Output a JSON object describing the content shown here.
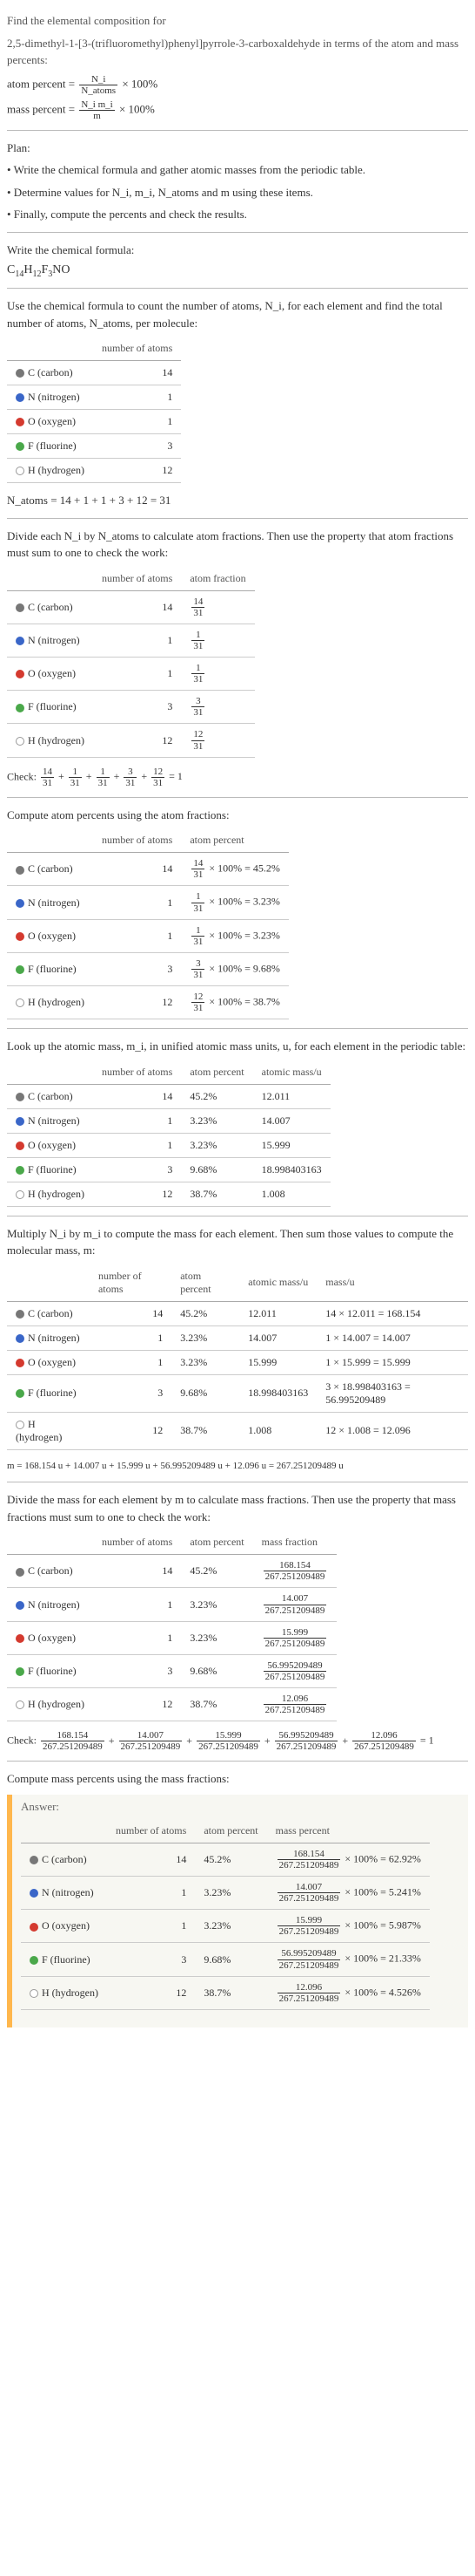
{
  "intro": {
    "line1": "Find the elemental composition for",
    "line2": "2,5-dimethyl-1-[3-(trifluoromethyl)phenyl]pyrrole-3-carboxaldehyde in terms of the atom and mass percents:"
  },
  "defs": {
    "atom_percent_prefix": "atom percent = ",
    "atom_percent_frac_num": "N_i",
    "atom_percent_frac_den": "N_atoms",
    "atom_percent_suffix": " × 100%",
    "mass_percent_prefix": "mass percent = ",
    "mass_percent_frac_num": "N_i m_i",
    "mass_percent_frac_den": "m",
    "mass_percent_suffix": " × 100%"
  },
  "plan": {
    "title": "Plan:",
    "b1": "• Write the chemical formula and gather atomic masses from the periodic table.",
    "b2": "• Determine values for N_i, m_i, N_atoms and m using these items.",
    "b3": "• Finally, compute the percents and check the results."
  },
  "step_formula": {
    "lead": "Write the chemical formula:",
    "formula_plain": "C14H12F3NO"
  },
  "step_count": {
    "lead": "Use the chemical formula to count the number of atoms, N_i, for each element and find the total number of atoms, N_atoms, per molecule:"
  },
  "elements": [
    {
      "key": "carbon",
      "label": "C (carbon)",
      "swatch": "carbon",
      "n": "14",
      "atom_frac_num": "14",
      "atom_frac_den": "31",
      "atom_pct": "45.2%",
      "mass_u": "12.011",
      "mass_expr": "14 × 12.011 = 168.154",
      "mass_frac_num": "168.154",
      "mass_frac_den": "267.251209489",
      "mass_pct": "62.92%",
      "mass_pct_frac_num": "168.154",
      "n_times_m": "14 × 12.011",
      "n_times_m_val": "168.154"
    },
    {
      "key": "nitrogen",
      "label": "N (nitrogen)",
      "swatch": "nitrogen",
      "n": "1",
      "atom_frac_num": "1",
      "atom_frac_den": "31",
      "atom_pct": "3.23%",
      "mass_u": "14.007",
      "mass_expr": "1 × 14.007 = 14.007",
      "mass_frac_num": "14.007",
      "mass_frac_den": "267.251209489",
      "mass_pct": "5.241%",
      "n_times_m": "1 × 14.007",
      "n_times_m_val": "14.007"
    },
    {
      "key": "oxygen",
      "label": "O (oxygen)",
      "swatch": "oxygen",
      "n": "1",
      "atom_frac_num": "1",
      "atom_frac_den": "31",
      "atom_pct": "3.23%",
      "mass_u": "15.999",
      "mass_expr": "1 × 15.999 = 15.999",
      "mass_frac_num": "15.999",
      "mass_frac_den": "267.251209489",
      "mass_pct": "5.987%",
      "n_times_m": "1 × 15.999",
      "n_times_m_val": "15.999"
    },
    {
      "key": "fluorine",
      "label": "F (fluorine)",
      "swatch": "fluorine",
      "n": "3",
      "atom_frac_num": "3",
      "atom_frac_den": "31",
      "atom_pct": "9.68%",
      "mass_u": "18.998403163",
      "mass_expr": "3 × 18.998403163 = 56.995209489",
      "mass_frac_num": "56.995209489",
      "mass_frac_den": "267.251209489",
      "mass_pct": "21.33%",
      "n_times_m": "3 × 18.998403163",
      "n_times_m_val": "56.995209489"
    },
    {
      "key": "hydrogen",
      "label": "H (hydrogen)",
      "swatch": "hydrogen",
      "n": "12",
      "atom_frac_num": "12",
      "atom_frac_den": "31",
      "atom_pct": "38.7%",
      "mass_u": "1.008",
      "mass_expr": "12 × 1.008 = 12.096",
      "mass_frac_num": "12.096",
      "mass_frac_den": "267.251209489",
      "mass_pct": "4.526%",
      "n_times_m": "12 × 1.008",
      "n_times_m_val": "12.096"
    }
  ],
  "headers": {
    "n_atoms": "number of atoms",
    "atom_fraction": "atom fraction",
    "atom_percent": "atom percent",
    "atomic_mass": "atomic mass/u",
    "mass_u": "mass/u",
    "mass_fraction": "mass fraction",
    "mass_percent": "mass percent"
  },
  "n_atoms_eq": "N_atoms = 14 + 1 + 1 + 3 + 12 = 31",
  "step_atom_frac": {
    "lead": "Divide each N_i by N_atoms to calculate atom fractions. Then use the property that atom fractions must sum to one to check the work:"
  },
  "check_atom_frac": {
    "prefix": "Check: ",
    "expr": "14/31 + 1/31 + 1/31 + 3/31 + 12/31 = 1"
  },
  "step_atom_pct": {
    "lead": "Compute atom percents using the atom fractions:"
  },
  "step_mass_lookup": {
    "lead": "Look up the atomic mass, m_i, in unified atomic mass units, u, for each element in the periodic table:"
  },
  "step_mass_per_el": {
    "lead": "Multiply N_i by m_i to compute the mass for each element. Then sum those values to compute the molecular mass, m:"
  },
  "molecular_mass_eq": "m = 168.154 u + 14.007 u + 15.999 u + 56.995209489 u + 12.096 u = 267.251209489 u",
  "step_mass_frac": {
    "lead": "Divide the mass for each element by m to calculate mass fractions. Then use the property that mass fractions must sum to one to check the work:"
  },
  "check_mass_frac": {
    "prefix": "Check: ",
    "suffix": " = 1"
  },
  "step_mass_pct": {
    "lead": "Compute mass percents using the mass fractions:"
  },
  "answer_label": "Answer:",
  "atom_pct_suffix": " × 100% = ",
  "mass_pct_suffix": " × 100% = "
}
